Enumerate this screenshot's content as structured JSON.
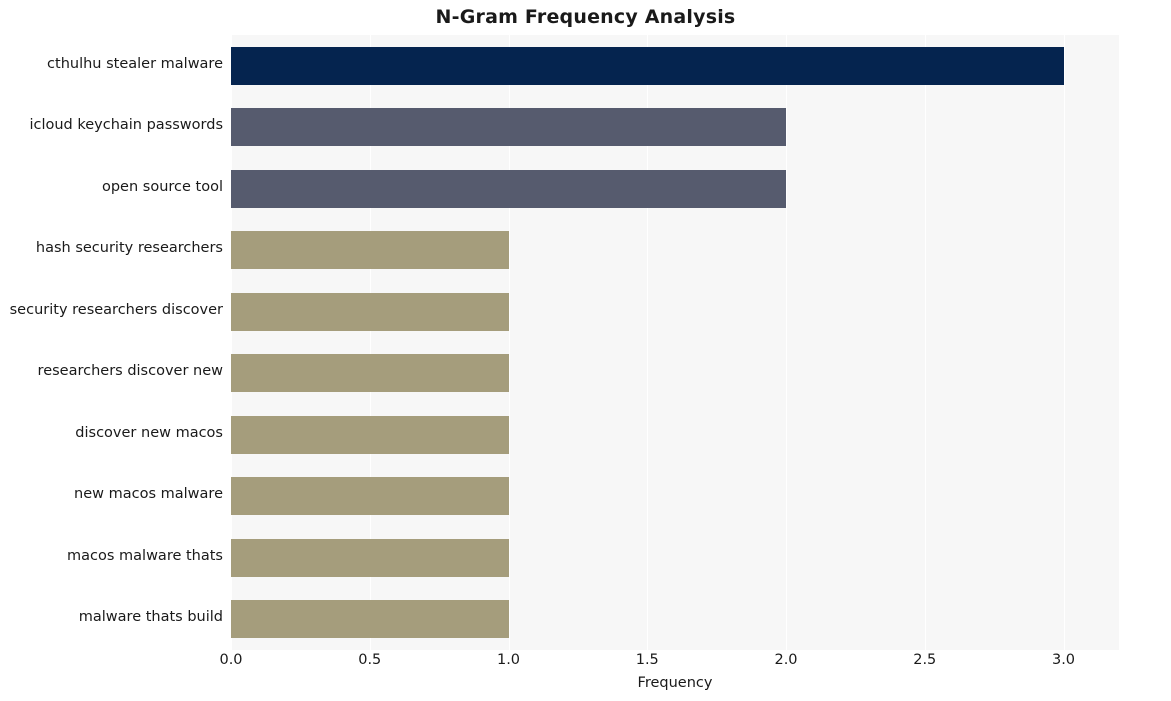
{
  "chart_data": {
    "type": "bar",
    "orientation": "horizontal",
    "title": "N-Gram Frequency Analysis",
    "xlabel": "Frequency",
    "ylabel": "",
    "xlim": [
      0.0,
      3.2
    ],
    "xticks": [
      "0.0",
      "0.5",
      "1.0",
      "1.5",
      "2.0",
      "2.5",
      "3.0"
    ],
    "xtick_values": [
      0.0,
      0.5,
      1.0,
      1.5,
      2.0,
      2.5,
      3.0
    ],
    "grid": true,
    "grid_axis": "x",
    "legend": "none",
    "categories": [
      "cthulhu stealer malware",
      "icloud keychain passwords",
      "open source tool",
      "hash security researchers",
      "security researchers discover",
      "researchers discover new",
      "discover new macos",
      "new macos malware",
      "macos malware thats",
      "malware thats build"
    ],
    "values": [
      3,
      2,
      2,
      1,
      1,
      1,
      1,
      1,
      1,
      1
    ],
    "bar_colors": [
      "#05244f",
      "#565b६e",
      "#565b6e",
      "#a59d7c",
      "#a59d7c",
      "#a59d7c",
      "#a59d7c",
      "#a59d7c",
      "#a59d7c",
      "#a59d7c"
    ],
    "colors": {
      "bar_high": "#05244f",
      "bar_mid": "#565b6e",
      "bar_low": "#a59d7c",
      "plot_background": "#f7f7f7",
      "grid": "#ffffff",
      "text": "#1a1a1a",
      "figure_background": "#ffffff"
    }
  }
}
